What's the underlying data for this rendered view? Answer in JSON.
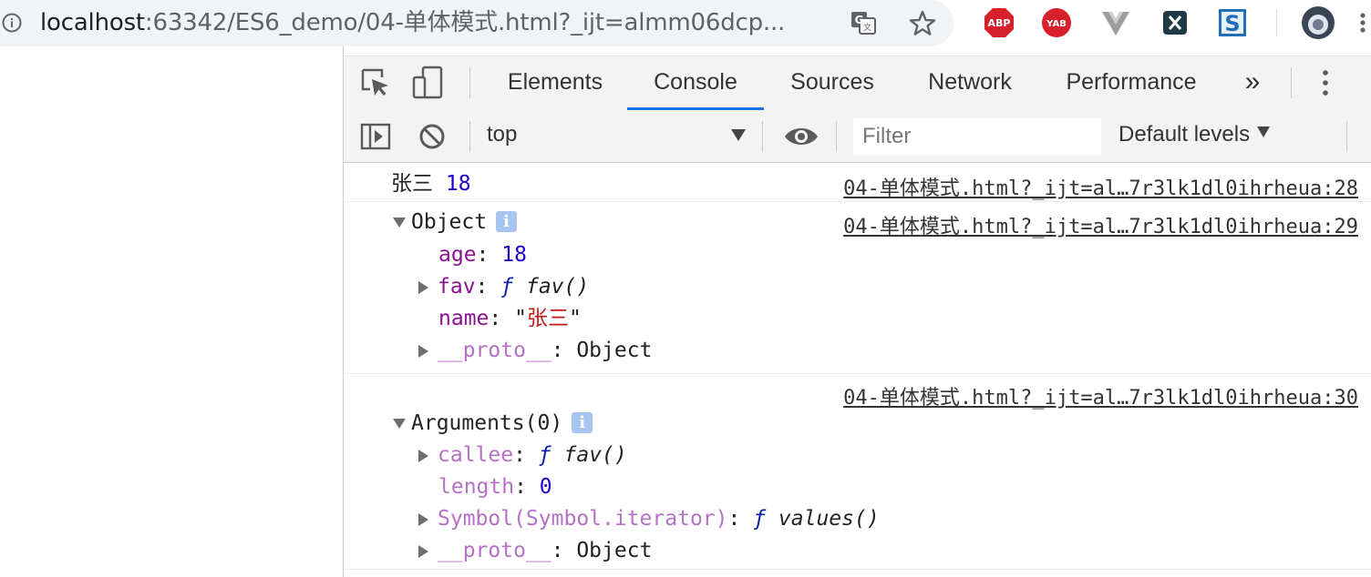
{
  "browser": {
    "url_host": "localhost",
    "url_rest": ":63342/ES6_demo/04-单体模式.html?_ijt=almm06dcp...",
    "extensions": [
      {
        "name": "ABP",
        "label": "ABP",
        "color": "#d6202b"
      },
      {
        "name": "YAB",
        "label": "YAB",
        "color": "#d6202b"
      }
    ]
  },
  "devtools": {
    "tabs": [
      {
        "label": "Elements"
      },
      {
        "label": "Console"
      },
      {
        "label": "Sources"
      },
      {
        "label": "Network"
      },
      {
        "label": "Performance"
      }
    ],
    "more_tabs": "»",
    "toolbar": {
      "context": "top",
      "filter_placeholder": "Filter",
      "levels": "Default levels"
    }
  },
  "console": {
    "messages": [
      {
        "text": "张三",
        "value": "18",
        "source": "04-单体模式.html?_ijt=al…7r3lk1dl0ihrheua:28"
      },
      {
        "header": "Object",
        "source": "04-单体模式.html?_ijt=al…7r3lk1dl0ihrheua:29",
        "props": {
          "age_key": "age",
          "age_val": "18",
          "fav_key": "fav",
          "fav_f": "ƒ",
          "fav_name": "fav()",
          "name_key": "name",
          "name_val": "张三",
          "proto_key": "__proto__",
          "proto_val": "Object"
        }
      },
      {
        "header": "Arguments(0)",
        "source": "04-单体模式.html?_ijt=al…7r3lk1dl0ihrheua:30",
        "props": {
          "callee_key": "callee",
          "callee_f": "ƒ",
          "callee_name": "fav()",
          "length_key": "length",
          "length_val": "0",
          "symbol_key": "Symbol(Symbol.iterator)",
          "symbol_f": "ƒ",
          "symbol_name": "values()",
          "proto_key": "__proto__",
          "proto_val": "Object"
        }
      }
    ]
  }
}
